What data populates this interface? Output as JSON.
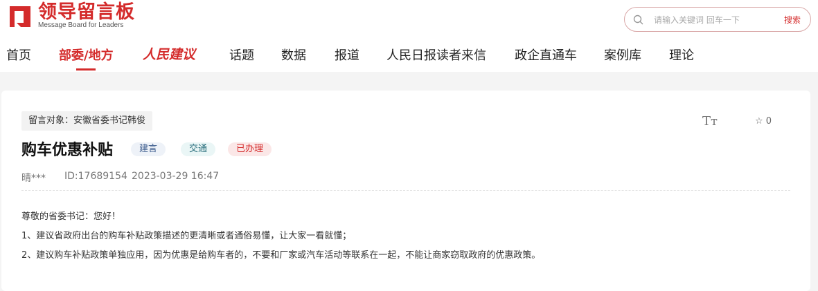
{
  "logo": {
    "title": "领导留言板",
    "subtitle": "Message Board for Leaders",
    "mark_color": "#d42b2b"
  },
  "search": {
    "placeholder": "请输入关键词 回车一下",
    "button_label": "搜索",
    "icon": "search-icon"
  },
  "nav": {
    "items": [
      {
        "label": "首页"
      },
      {
        "label": "部委/地方",
        "active": true
      },
      {
        "label": "人民建议"
      },
      {
        "label": "话题"
      },
      {
        "label": "数据"
      },
      {
        "label": "报道"
      },
      {
        "label": "人民日报读者来信"
      },
      {
        "label": "政企直通车"
      },
      {
        "label": "案例库"
      },
      {
        "label": "理论"
      }
    ]
  },
  "message": {
    "target": "留言对象：安徽省委书记韩俊",
    "title": "购车优惠补贴",
    "tags": [
      "建言",
      "交通",
      "已办理"
    ],
    "author": "晴***",
    "id": "ID:17689154",
    "datetime": "2023-03-29 16:47",
    "font_toggle": "Tт",
    "favorite_count": "0",
    "body": [
      "尊敬的省委书记：您好！",
      "1、建议省政府出台的购车补贴政策描述的更清晰或者通俗易懂，让大家一看就懂；",
      "2、建议购车补贴政策单独应用，因为优惠是给购车者的，不要和厂家或汽车活动等联系在一起，不能让商家窃取政府的优惠政策。"
    ]
  },
  "colors": {
    "accent": "#d42b2b",
    "page_bg": "#f4f4f4",
    "card_bg": "#ffffff"
  }
}
